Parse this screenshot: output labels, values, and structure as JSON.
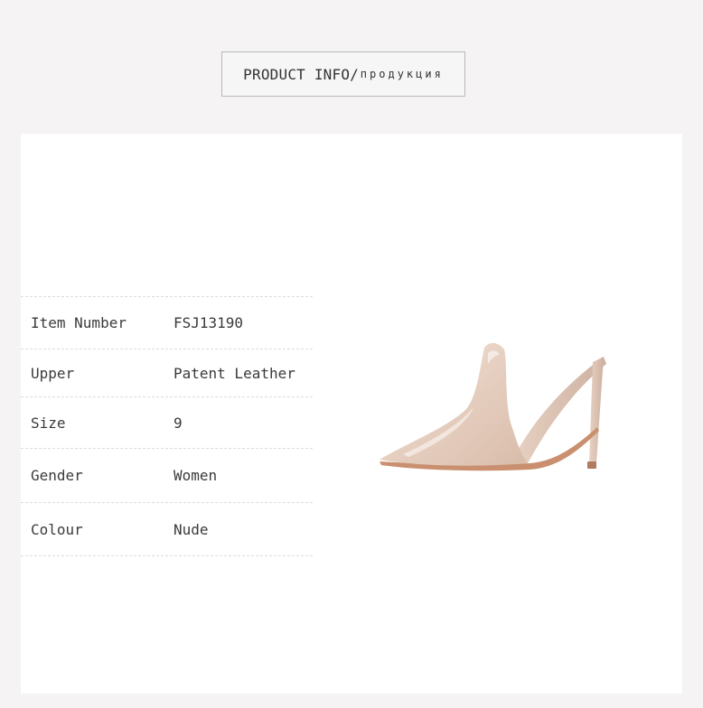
{
  "header": {
    "title_en": "PRODUCT INFO",
    "separator": "/",
    "title_ru": "продукция"
  },
  "specs": [
    {
      "label": "Item Number",
      "value": "FSJ13190"
    },
    {
      "label": "Upper",
      "value": "Patent Leather"
    },
    {
      "label": "Size",
      "value": "9"
    },
    {
      "label": "Gender",
      "value": "Women"
    },
    {
      "label": "Colour",
      "value": "Nude"
    }
  ],
  "colors": {
    "page_bg": "#f5f3f3",
    "panel_bg": "#ffffff",
    "shoe_nude": "#ecd6c8",
    "shoe_sole": "#c98f6f"
  }
}
